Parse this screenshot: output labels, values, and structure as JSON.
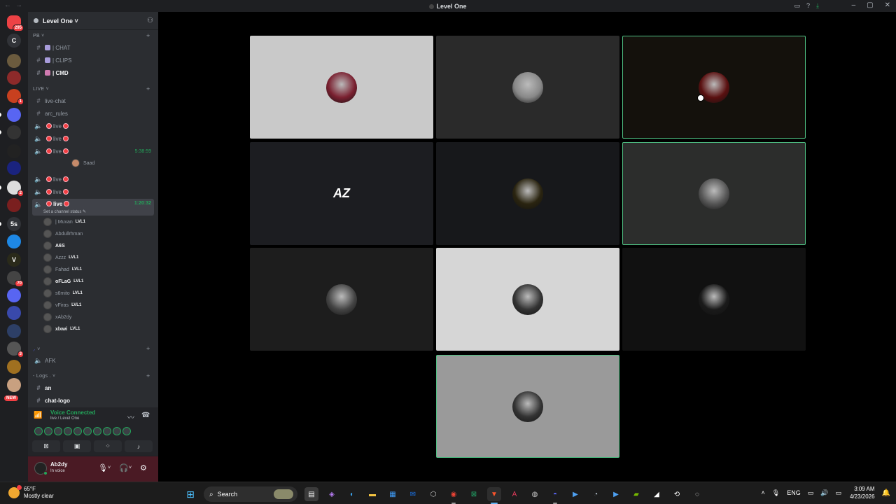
{
  "window": {
    "title": "Level One",
    "nav_back": "←",
    "nav_forward": "→"
  },
  "servers": [
    {
      "label": "",
      "badge": "295",
      "color": "#ed4245"
    },
    {
      "label": "C",
      "badge": "",
      "color": "#313338"
    },
    {
      "label": "",
      "badge": "",
      "color": "#6b5b3e"
    },
    {
      "label": "",
      "badge": "",
      "color": "#8c2a2a"
    },
    {
      "label": "",
      "badge": "1",
      "color": "#c8401f"
    },
    {
      "label": "",
      "badge": "",
      "color": "#5865f2"
    },
    {
      "label": "",
      "badge": "",
      "color": "#333"
    },
    {
      "label": "",
      "badge": "",
      "color": "#222"
    },
    {
      "label": "",
      "badge": "",
      "color": "#1a237e"
    },
    {
      "label": "",
      "badge": "2",
      "color": "#ddd"
    },
    {
      "label": "",
      "badge": "",
      "color": "#7a1f1f"
    },
    {
      "label": "5s",
      "badge": "",
      "color": "#313338"
    },
    {
      "label": "",
      "badge": "",
      "color": "#1e88e5"
    },
    {
      "label": "V",
      "badge": "",
      "color": "#2a2a1a"
    },
    {
      "label": "",
      "badge": "70",
      "color": "#444"
    },
    {
      "label": "",
      "badge": "",
      "color": "#5865f2"
    },
    {
      "label": "",
      "badge": "",
      "color": "#3949ab"
    },
    {
      "label": "",
      "badge": "",
      "color": "#2d3f66"
    },
    {
      "label": "",
      "badge": "3",
      "color": "#555"
    },
    {
      "label": "",
      "badge": "",
      "color": "#a07020"
    },
    {
      "label": "",
      "badge": "",
      "color": "#c8a080"
    }
  ],
  "rail": {
    "new_badge": "NEW"
  },
  "guild": {
    "name": "Level One ˅"
  },
  "categories": [
    {
      "label": "PB ˅"
    },
    {
      "label": "LIVE ˅"
    },
    {
      "label": "˅"
    },
    {
      "label": "- Logs . ˅"
    }
  ],
  "channels": {
    "chat": "| CHAT",
    "clips": "| CLIPS",
    "cmd": "| CMD",
    "live_chat": "live-chat",
    "arc_rules": "arc_rules",
    "live1": "live",
    "live2": "live",
    "live3": "live",
    "live3_timer": "5:38:59",
    "live3_user": "Saad",
    "live4": "live",
    "live5": "live",
    "live6": "live",
    "live6_timer": "1:20:32",
    "live6_status": "Set a channel status ✎",
    "afk": "AFK",
    "an": "an",
    "chat_logo": "chat-logo"
  },
  "voice_users": [
    {
      "name": "| Muvan",
      "tag": "LVL1",
      "strong": false
    },
    {
      "name": "Abdullrhman",
      "tag": "",
      "strong": false
    },
    {
      "name": "A6S",
      "tag": "",
      "strong": true
    },
    {
      "name": "Azzz",
      "tag": "LVL1",
      "strong": false
    },
    {
      "name": "Fahad",
      "tag": "LVL1",
      "strong": false
    },
    {
      "name": "oFLaG",
      "tag": "LVL1",
      "strong": true
    },
    {
      "name": "s6mito",
      "tag": "LVL1",
      "strong": false
    },
    {
      "name": "vFiras",
      "tag": "LVL1",
      "strong": false
    },
    {
      "name": "xAb2dy",
      "tag": "",
      "strong": false
    },
    {
      "name": "xlxwi",
      "tag": "LVL1",
      "strong": true
    }
  ],
  "voice_panel": {
    "status": "Voice Connected",
    "channel": "live / Level One"
  },
  "user_panel": {
    "name": "Ab2dy",
    "sub": "In voice"
  },
  "tiles": [
    {
      "bg": "#c9c9c9",
      "avatar": "#7a2030",
      "speaking": false
    },
    {
      "bg": "#2a2a2a",
      "avatar": "#888",
      "speaking": false
    },
    {
      "bg": "#14110c",
      "avatar": "#5a1010",
      "speaking": true
    },
    {
      "bg": "#1c1d21",
      "avatar": "",
      "text": "AZ",
      "speaking": false
    },
    {
      "bg": "#17181b",
      "avatar": "#2a2410",
      "speaking": false
    },
    {
      "bg": "#2c2d2c",
      "avatar": "#555",
      "speaking": true
    },
    {
      "bg": "#1d1d1d",
      "avatar": "#444",
      "speaking": false
    },
    {
      "bg": "#d6d6d6",
      "avatar": "#333",
      "speaking": false
    },
    {
      "bg": "#111",
      "avatar": "#1a1a1a",
      "speaking": false
    },
    {
      "bg": "#9a9a9a",
      "avatar": "#333",
      "speaking": true
    }
  ],
  "taskbar": {
    "temp": "65°F",
    "condition": "Mostly clear",
    "search": "Search",
    "lang": "ENG",
    "time": "3:09 AM",
    "date": "4/23/2026"
  }
}
